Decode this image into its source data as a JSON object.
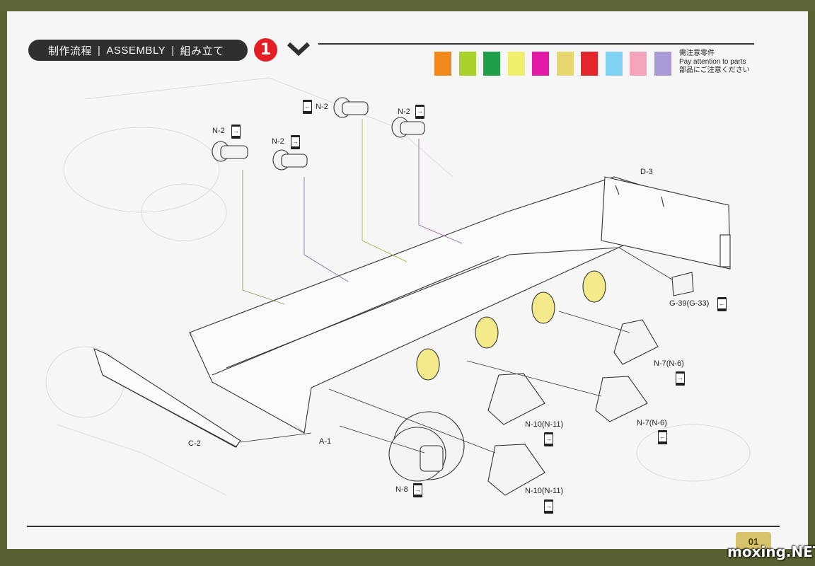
{
  "header": {
    "cn": "制作流程",
    "en": "ASSEMBLY",
    "jp": "組み立て",
    "step": "1"
  },
  "attention": {
    "cn": "需注意零件",
    "en": "Pay attention to parts",
    "jp": "部品にご注意ください",
    "colors": [
      "#f08a1d",
      "#a8d12c",
      "#1e9f48",
      "#f0ef6c",
      "#e31aa6",
      "#e7d66e",
      "#e3262a",
      "#7fd2f1",
      "#f5a3bb",
      "#a79ad6"
    ]
  },
  "parts": {
    "n2_a": "N-2",
    "n2_b": "N-2",
    "n2_c": "N-2",
    "n2_d": "N-2",
    "d3": "D-3",
    "g39": "G-39(G-33)",
    "n7_a": "N-7(N-6)",
    "n7_b": "N-7(N-6)",
    "n10_a": "N-10(N-11)",
    "n10_b": "N-10(N-11)",
    "n8": "N-8",
    "a1": "A-1",
    "c2": "C-2"
  },
  "page_number": "01",
  "watermark": "moxing.NET"
}
